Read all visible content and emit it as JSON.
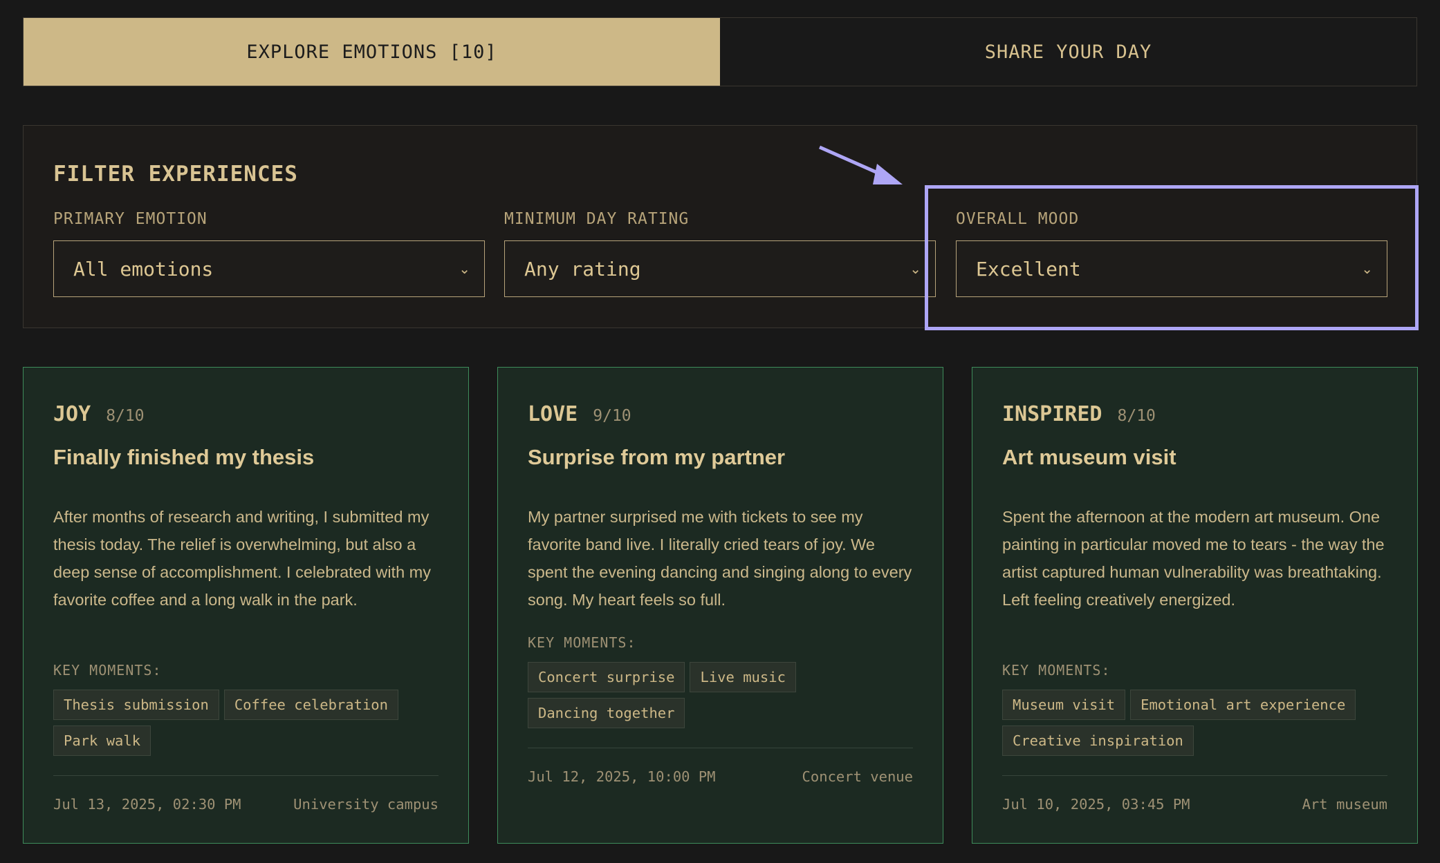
{
  "tabs": {
    "explore": "EXPLORE EMOTIONS [10]",
    "share": "SHARE YOUR DAY"
  },
  "filters": {
    "title": "FILTER EXPERIENCES",
    "primary_emotion": {
      "label": "PRIMARY EMOTION",
      "value": "All emotions"
    },
    "min_rating": {
      "label": "MINIMUM DAY RATING",
      "value": "Any rating"
    },
    "overall_mood": {
      "label": "OVERALL MOOD",
      "value": "Excellent"
    }
  },
  "cards": [
    {
      "emotion": "JOY",
      "rating": "8/10",
      "title": "Finally finished my thesis",
      "body": "After months of research and writing, I submitted my thesis today. The relief is overwhelming, but also a deep sense of accomplishment. I celebrated with my favorite coffee and a long walk in the park.",
      "key_moments_label": "KEY MOMENTS:",
      "tags": [
        "Thesis submission",
        "Coffee celebration",
        "Park walk"
      ],
      "date": "Jul 13, 2025, 02:30 PM",
      "location": "University campus"
    },
    {
      "emotion": "LOVE",
      "rating": "9/10",
      "title": "Surprise from my partner",
      "body": "My partner surprised me with tickets to see my favorite band live. I literally cried tears of joy. We spent the evening dancing and singing along to every song. My heart feels so full.",
      "key_moments_label": "KEY MOMENTS:",
      "tags": [
        "Concert surprise",
        "Live music",
        "Dancing together"
      ],
      "date": "Jul 12, 2025, 10:00 PM",
      "location": "Concert venue"
    },
    {
      "emotion": "INSPIRED",
      "rating": "8/10",
      "title": "Art museum visit",
      "body": "Spent the afternoon at the modern art museum. One painting in particular moved me to tears - the way the artist captured human vulnerability was breathtaking. Left feeling creatively energized.",
      "key_moments_label": "KEY MOMENTS:",
      "tags": [
        "Museum visit",
        "Emotional art experience",
        "Creative inspiration"
      ],
      "date": "Jul 10, 2025, 03:45 PM",
      "location": "Art museum"
    }
  ],
  "colors": {
    "background": "#181818",
    "accent": "#cdb887",
    "card_bg": "#1c2a22",
    "card_border": "#3e8c5b",
    "highlight": "#aea6f5"
  }
}
